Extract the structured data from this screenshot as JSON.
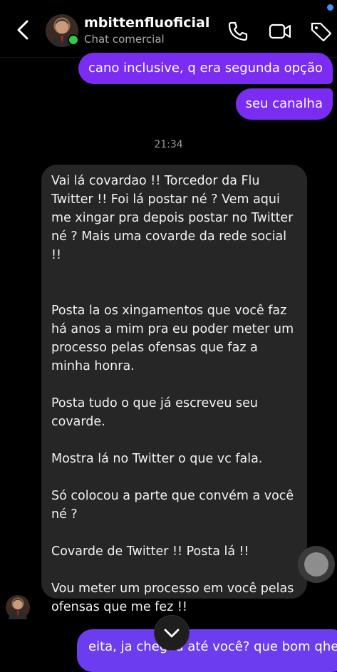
{
  "header": {
    "username": "mbittenfluoficial",
    "subtitle": "Chat comercial"
  },
  "messages_out_top": [
    "cano inclusive, q era segunda opção",
    "seu canalha"
  ],
  "timestamp": "21:34",
  "incoming_message": {
    "paragraphs": [
      "Vai lá covardao  !! Torcedor da Flu Twitter  !! Foi lá postar né ? Vem aqui me xingar pra depois postar no Twitter né ? Mais uma covarde da rede social !!",
      "Posta la os xingamentos que você faz há anos a mim pra eu poder meter um processo pelas ofensas que faz a minha honra.",
      "Posta tudo o que já escreveu seu covarde.",
      "Mostra lá no Twitter o que vc fala.",
      "Só colocou a parte que convém a você né ?",
      "Covarde de Twitter !! Posta lá !!",
      "Vou meter um processo em você pelas ofensas que me fez !!"
    ]
  },
  "message_out_bottom": "eita, ja chegou até você? que bom qhe",
  "colors": {
    "outgoing_bubble": "#7b2cf2",
    "incoming_bubble": "#262626",
    "online": "#2ecc40",
    "notification": "#3897f0"
  }
}
